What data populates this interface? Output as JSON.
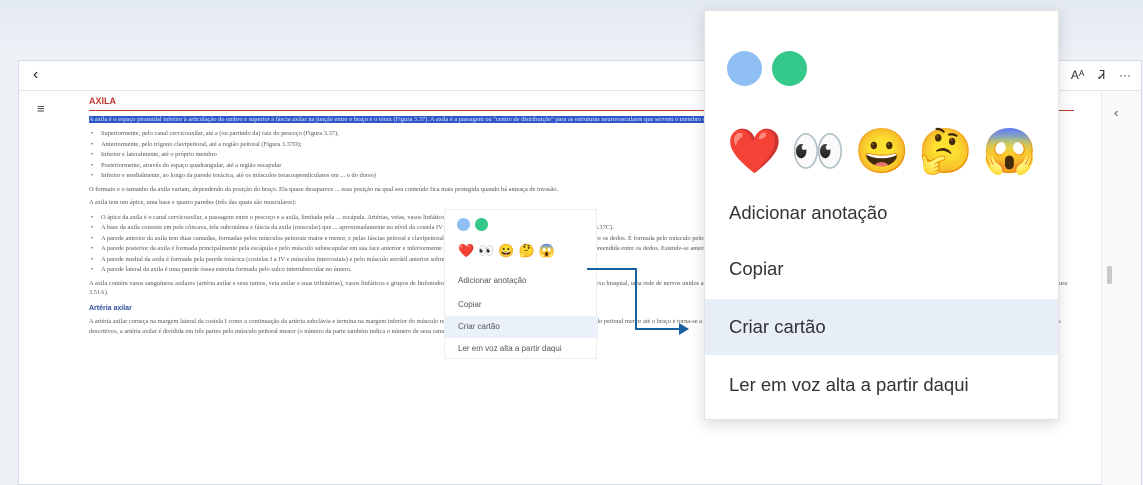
{
  "colors": {
    "blue_dot": "#8fbff2",
    "green_dot": "#34c88a",
    "highlight": "#2f57c8",
    "heading": "#c0392b",
    "arrow": "#1a5fa0"
  },
  "toolbar": {
    "back_icon": "chevron-left-icon",
    "read_aloud": "Aᴬ",
    "page_icon": "Ꮨ",
    "more": "···"
  },
  "sidebar": {
    "menu_icon": "≡",
    "chevron_icon": "‹"
  },
  "document": {
    "title": "AXILA",
    "highlighted_text": "A axila é o espaço piramidal inferior à articulação do ombro e superior à fáscia axilar na junção entre o braço e o tórax (Figura 3.37). A axila é a passagem ou \"centro de distribuição\" para as estruturas neurovasculares que servem o membro superior. A partir deste centro de distribuição, as estruturas neurovasculares seguem.",
    "bullets": [
      "Superiormente, pelo canal cervicoaxilar, até a (ou partindo da) raiz do pescoço (Figura 3.37);",
      "Anteriormente, pelo trígono clavipeitoral, até a região peitoral (Figura 3.37D);",
      "Inferior e lateralmente, até o próprio membro",
      "Posteriormente, através do espaço quadrangular, até a região escapular",
      "Inferior e medialmente, ao longo da parede torácica, até os músculos toracoapendiculares em ... o do dorso)"
    ],
    "para1": "O formato e o tamanho da axila variam, dependendo da posição do braço. Ela quase desaparece ... essa posição na qual seu conteúdo fica mais protegida quando há ameaça de invasão.",
    "para2": "A axila tem um ápice, uma base e quatro paredes (três das quais são musculares):",
    "bullets2": [
      "O ápice da axila é o canal cervicoaxilar, a passagem entre o pescoço e a axila, limitada pela ... escápula. Artérias, veias, vasos linfáticos e nervos",
      "A base da axila consiste em pele côncava, tela subcutânea e fáscia da axila (muscular) que ... aproximadamente no nível da costela IV e posterior, parede torácica e face medial do braço (Figura 3.37C).",
      "A parede anterior da axila tem duas camadas, formadas pelos músculos peitorais maior e menor, e pelas fáscias peitoral e clavipeitoral associadas a eles (Figuras 3.13B e ... pode ser segurada entre os dedos. É formada pelo músculo peitoral maior, quando este segue da parede torácica até o úmero, e o tegumento sobrejacente (Figura 3.37C e D).",
      "A parede posterior da axila é formada principalmente pela escápula e pelo músculo subescapular em sua face anterior e inferiormente pelos músculos redondo maior e latíssimo do dorso ... ser apreendida entre os dedos. Estende-se anteriormente à parede anterior e é formada pelos músculos latíssimo do dorso e redondo maior e tegumento sobrejacente.",
      "A parede medial da axila é formada pela parede torácica (costelas I a IV e músculos intercostais) e pelo músculo serrátil anterior sobrejacente (Figura 3.37A e B).",
      "A parede lateral da axila é uma parede óssea estreita formada pelo sulco intertubercular no úmero."
    ],
    "para3": "A axila contém vasos sanguíneos axilares (artéria axilar e seus ramos, veia axilar e suas tributárias), vasos linfáticos e grupos de linfonodos axilares, todos envolvidos por uma ... vasos, e ramos do plexo braquial, uma rede de nervos unidos aos seus outros, que seguem do pescoço até o membro superior (Figura 3.38B). Na região proximal, essas estruturas neurovasculares ... (Figura 3.51A).",
    "subheading": "Artéria axilar",
    "para4": "A artéria axilar começa na margem lateral da costela I como a continuação da artéria subclávia e termina na margem inferior do músculo redondo maior (Figura 3.39). Segue posteriormente ao músculo peitoral menor até o braço e torna-se a artéria braquial quando passa pela margem inferior do músculo redondo maior, geralmente tendo chegado ao úmero (Figura 3.39). Para fins descritivos, a artéria axilar é dividida em três partes pelo músculo peitoral menor (o número da parte também indica o número de seus ramos):"
  },
  "context_menu": {
    "emojis": [
      "❤️",
      "👀",
      "😀",
      "🤔",
      "😱"
    ],
    "emoji_names": [
      "heart",
      "eyes",
      "grinning-face",
      "thinking-face",
      "screaming-face"
    ],
    "items": [
      "Adicionar anotação",
      "Copiar",
      "Criar cartão",
      "Ler em voz alta a partir daqui"
    ],
    "active_item": "Criar cartão"
  }
}
